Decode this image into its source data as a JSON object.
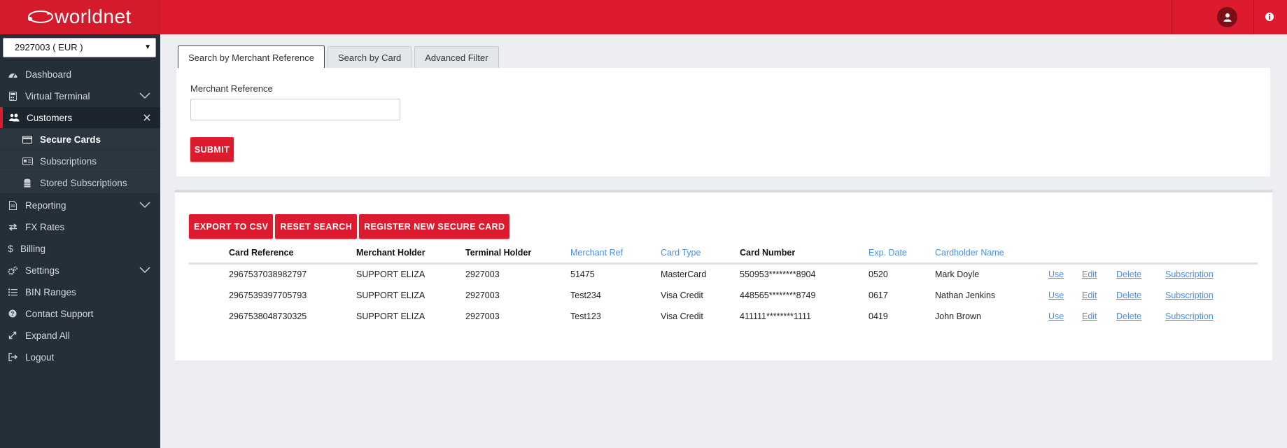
{
  "app": {
    "logo_text": "worldnet"
  },
  "colors": {
    "brand_red": "#dc1b2e",
    "sidebar_bg": "#252f38",
    "link_blue": "#4a90e2"
  },
  "header": {
    "user_icon": "user-icon",
    "info_icon": "info-icon"
  },
  "sidebar": {
    "account_select": "2927003 ( EUR )",
    "items": [
      {
        "label": "Dashboard",
        "icon": "dashboard-icon"
      },
      {
        "label": "Virtual Terminal",
        "icon": "calculator-icon"
      },
      {
        "label": "Customers",
        "icon": "users-icon"
      },
      {
        "label": "Reporting",
        "icon": "document-icon"
      },
      {
        "label": "FX Rates",
        "icon": "exchange-icon"
      },
      {
        "label": "Billing",
        "icon": "dollar-icon"
      },
      {
        "label": "Settings",
        "icon": "gears-icon"
      },
      {
        "label": "BIN Ranges",
        "icon": "list-icon"
      },
      {
        "label": "Contact Support",
        "icon": "question-icon"
      },
      {
        "label": "Expand All",
        "icon": "expand-icon"
      },
      {
        "label": "Logout",
        "icon": "logout-icon"
      }
    ],
    "sub_items": [
      {
        "label": "Secure Cards",
        "icon": "credit-card-icon"
      },
      {
        "label": "Subscriptions",
        "icon": "id-card-icon"
      },
      {
        "label": "Stored Subscriptions",
        "icon": "database-icon"
      }
    ]
  },
  "tabs": [
    "Search by Merchant Reference",
    "Search by Card",
    "Advanced Filter"
  ],
  "search": {
    "label": "Merchant Reference",
    "value": "",
    "submit": "SUBMIT"
  },
  "actions": {
    "export": "EXPORT TO CSV",
    "reset": "RESET SEARCH",
    "register": "REGISTER NEW SECURE CARD"
  },
  "table": {
    "headers": [
      "Card Reference",
      "Merchant Holder",
      "Terminal Holder",
      "Merchant Ref",
      "Card Type",
      "Card Number",
      "Exp. Date",
      "Cardholder Name"
    ],
    "row_actions": [
      "Use",
      "Edit",
      "Delete",
      "Subscription"
    ],
    "rows": [
      [
        "2967537038982797",
        "SUPPORT ELIZA",
        "2927003",
        "51475",
        "MasterCard",
        "550953********8904",
        "0520",
        "Mark Doyle"
      ],
      [
        "2967539397705793",
        "SUPPORT ELIZA",
        "2927003",
        "Test234",
        "Visa Credit",
        "448565********8749",
        "0617",
        "Nathan Jenkins"
      ],
      [
        "2967538048730325",
        "SUPPORT ELIZA",
        "2927003",
        "Test123",
        "Visa Credit",
        "411111********1111",
        "0419",
        "John Brown"
      ]
    ]
  }
}
